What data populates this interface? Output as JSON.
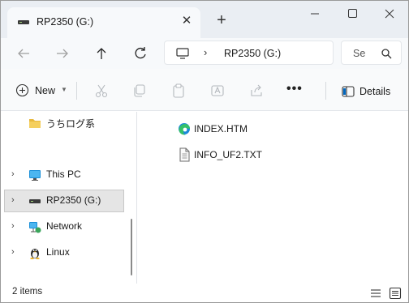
{
  "tab": {
    "title": "RP2350 (G:)",
    "close": "✕",
    "new_tab": "+"
  },
  "address": {
    "drive": "RP2350 (G:)",
    "separator": "›"
  },
  "search": {
    "placeholder": "Se"
  },
  "toolbar": {
    "new_label": "New",
    "details_label": "Details",
    "more": "•••"
  },
  "nav": {
    "items": [
      {
        "label": "うちログ系",
        "icon": "folder-icon",
        "chevron": ""
      },
      {
        "label": "This PC",
        "icon": "monitor-icon",
        "chevron": "›"
      },
      {
        "label": "RP2350 (G:)",
        "icon": "drive-icon",
        "chevron": "›"
      },
      {
        "label": "Network",
        "icon": "network-icon",
        "chevron": "›"
      },
      {
        "label": "Linux",
        "icon": "linux-icon",
        "chevron": "›"
      }
    ]
  },
  "files": [
    {
      "name": "INDEX.HTM",
      "icon": "edge-icon"
    },
    {
      "name": "INFO_UF2.TXT",
      "icon": "text-file-icon"
    }
  ],
  "status": {
    "count": "2 items"
  },
  "colors": {
    "accent": "#0067c0",
    "folder": "#e8b93e",
    "titlebar": "#eaeef3"
  }
}
